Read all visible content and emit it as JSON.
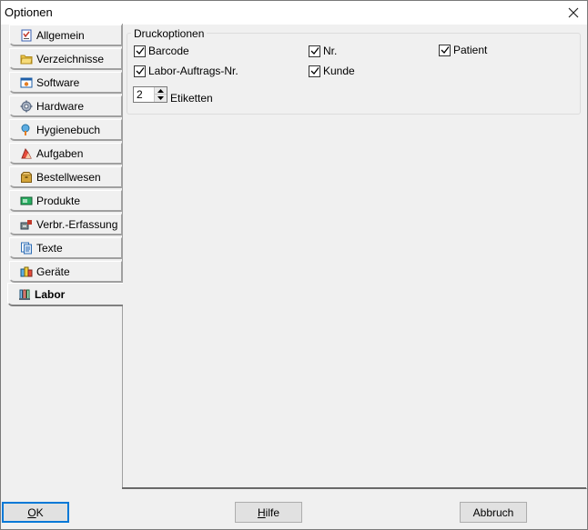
{
  "window": {
    "title": "Optionen"
  },
  "tabs": [
    {
      "label": "Allgemein",
      "icon": "checklist-icon"
    },
    {
      "label": "Verzeichnisse",
      "icon": "folder-icon"
    },
    {
      "label": "Software",
      "icon": "software-icon"
    },
    {
      "label": "Hardware",
      "icon": "gear-icon"
    },
    {
      "label": "Hygienebuch",
      "icon": "hygiene-icon"
    },
    {
      "label": "Aufgaben",
      "icon": "tasks-icon"
    },
    {
      "label": "Bestellwesen",
      "icon": "package-icon"
    },
    {
      "label": "Produkte",
      "icon": "products-icon"
    },
    {
      "label": "Verbr.-Erfassung",
      "icon": "consumption-icon"
    },
    {
      "label": "Texte",
      "icon": "document-icon"
    },
    {
      "label": "Geräte",
      "icon": "devices-icon"
    },
    {
      "label": "Labor",
      "icon": "lab-icon",
      "active": true
    }
  ],
  "druckoptionen": {
    "legend": "Druckoptionen",
    "checkboxes": [
      {
        "label": "Barcode",
        "checked": true
      },
      {
        "label": "Nr.",
        "checked": true
      },
      {
        "label": "Patient",
        "checked": true
      },
      {
        "label": "Labor-Auftrags-Nr.",
        "checked": true
      },
      {
        "label": "Kunde",
        "checked": true
      }
    ],
    "etiketten": {
      "value": "2",
      "label": "Etiketten"
    }
  },
  "buttons": {
    "ok": {
      "underline": "O",
      "rest": "K"
    },
    "hilfe": {
      "underline": "H",
      "rest": "ilfe"
    },
    "abbruch": {
      "label": "Abbruch"
    }
  },
  "colors": {
    "accent": "#0078d7",
    "background": "#f0f0f0"
  }
}
